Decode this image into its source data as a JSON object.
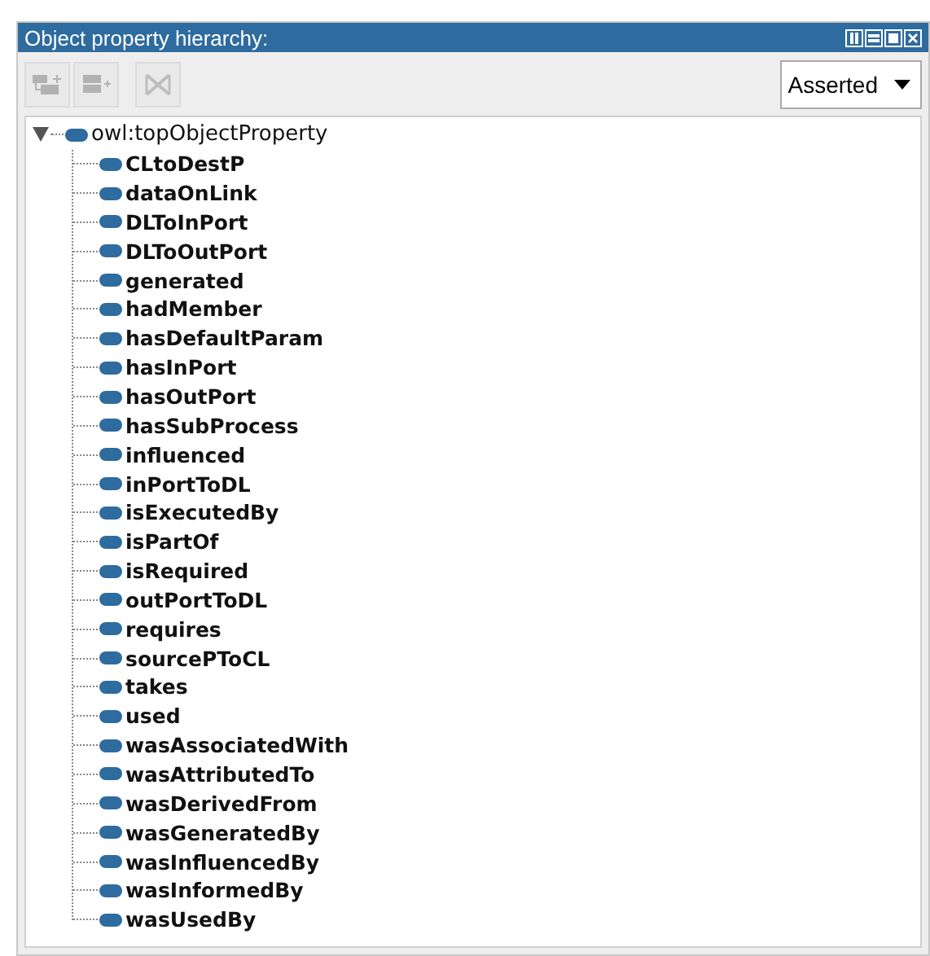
{
  "panel": {
    "title": "Object property hierarchy:"
  },
  "toolbar": [
    {
      "kind": "add-sub",
      "disabled": true
    },
    {
      "kind": "add-sibling",
      "disabled": true
    },
    {
      "kind": "delete",
      "disabled": true
    }
  ],
  "view_selector": {
    "value": "Asserted"
  },
  "tree": [
    {
      "label": "owl:topObjectProperty",
      "expanded": true,
      "children": [
        {
          "label": "CLtoDestP"
        },
        {
          "label": "dataOnLink"
        },
        {
          "label": "DLToInPort"
        },
        {
          "label": "DLToOutPort"
        },
        {
          "label": "generated"
        },
        {
          "label": "hadMember"
        },
        {
          "label": "hasDefaultParam"
        },
        {
          "label": "hasInPort"
        },
        {
          "label": "hasOutPort"
        },
        {
          "label": "hasSubProcess"
        },
        {
          "label": "influenced"
        },
        {
          "label": "inPortToDL"
        },
        {
          "label": "isExecutedBy"
        },
        {
          "label": "isPartOf"
        },
        {
          "label": "isRequired"
        },
        {
          "label": "outPortToDL"
        },
        {
          "label": "requires"
        },
        {
          "label": "sourcePToCL"
        },
        {
          "label": "takes"
        },
        {
          "label": "used"
        },
        {
          "label": "wasAssociatedWith"
        },
        {
          "label": "wasAttributedTo"
        },
        {
          "label": "wasDerivedFrom"
        },
        {
          "label": "wasGeneratedBy"
        },
        {
          "label": "wasInfluencedBy"
        },
        {
          "label": "wasInformedBy"
        },
        {
          "label": "wasUsedBy"
        }
      ]
    }
  ]
}
